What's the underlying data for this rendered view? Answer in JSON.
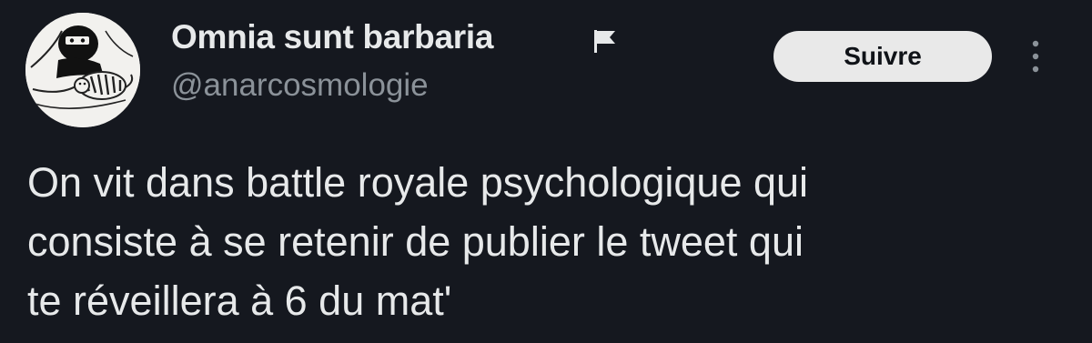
{
  "author": {
    "display_name": "Omnia sunt barbaria",
    "handle": "@anarcosmologie",
    "avatar_icon": "hooded-figure-with-tiger-avatar",
    "badge_icon": "flag-icon"
  },
  "actions": {
    "follow_label": "Suivre",
    "more_icon": "vertical-ellipsis-icon"
  },
  "tweet": {
    "lines": [
      "On vit dans battle royale psychologique qui",
      "consiste à se retenir de publier le tweet qui",
      "te réveillera à 6 du mat'"
    ]
  },
  "colors": {
    "background": "#15181f",
    "text_primary": "#e7e9ea",
    "text_secondary": "#8b9299",
    "button_bg": "#e9e9e9",
    "button_text": "#101318"
  }
}
